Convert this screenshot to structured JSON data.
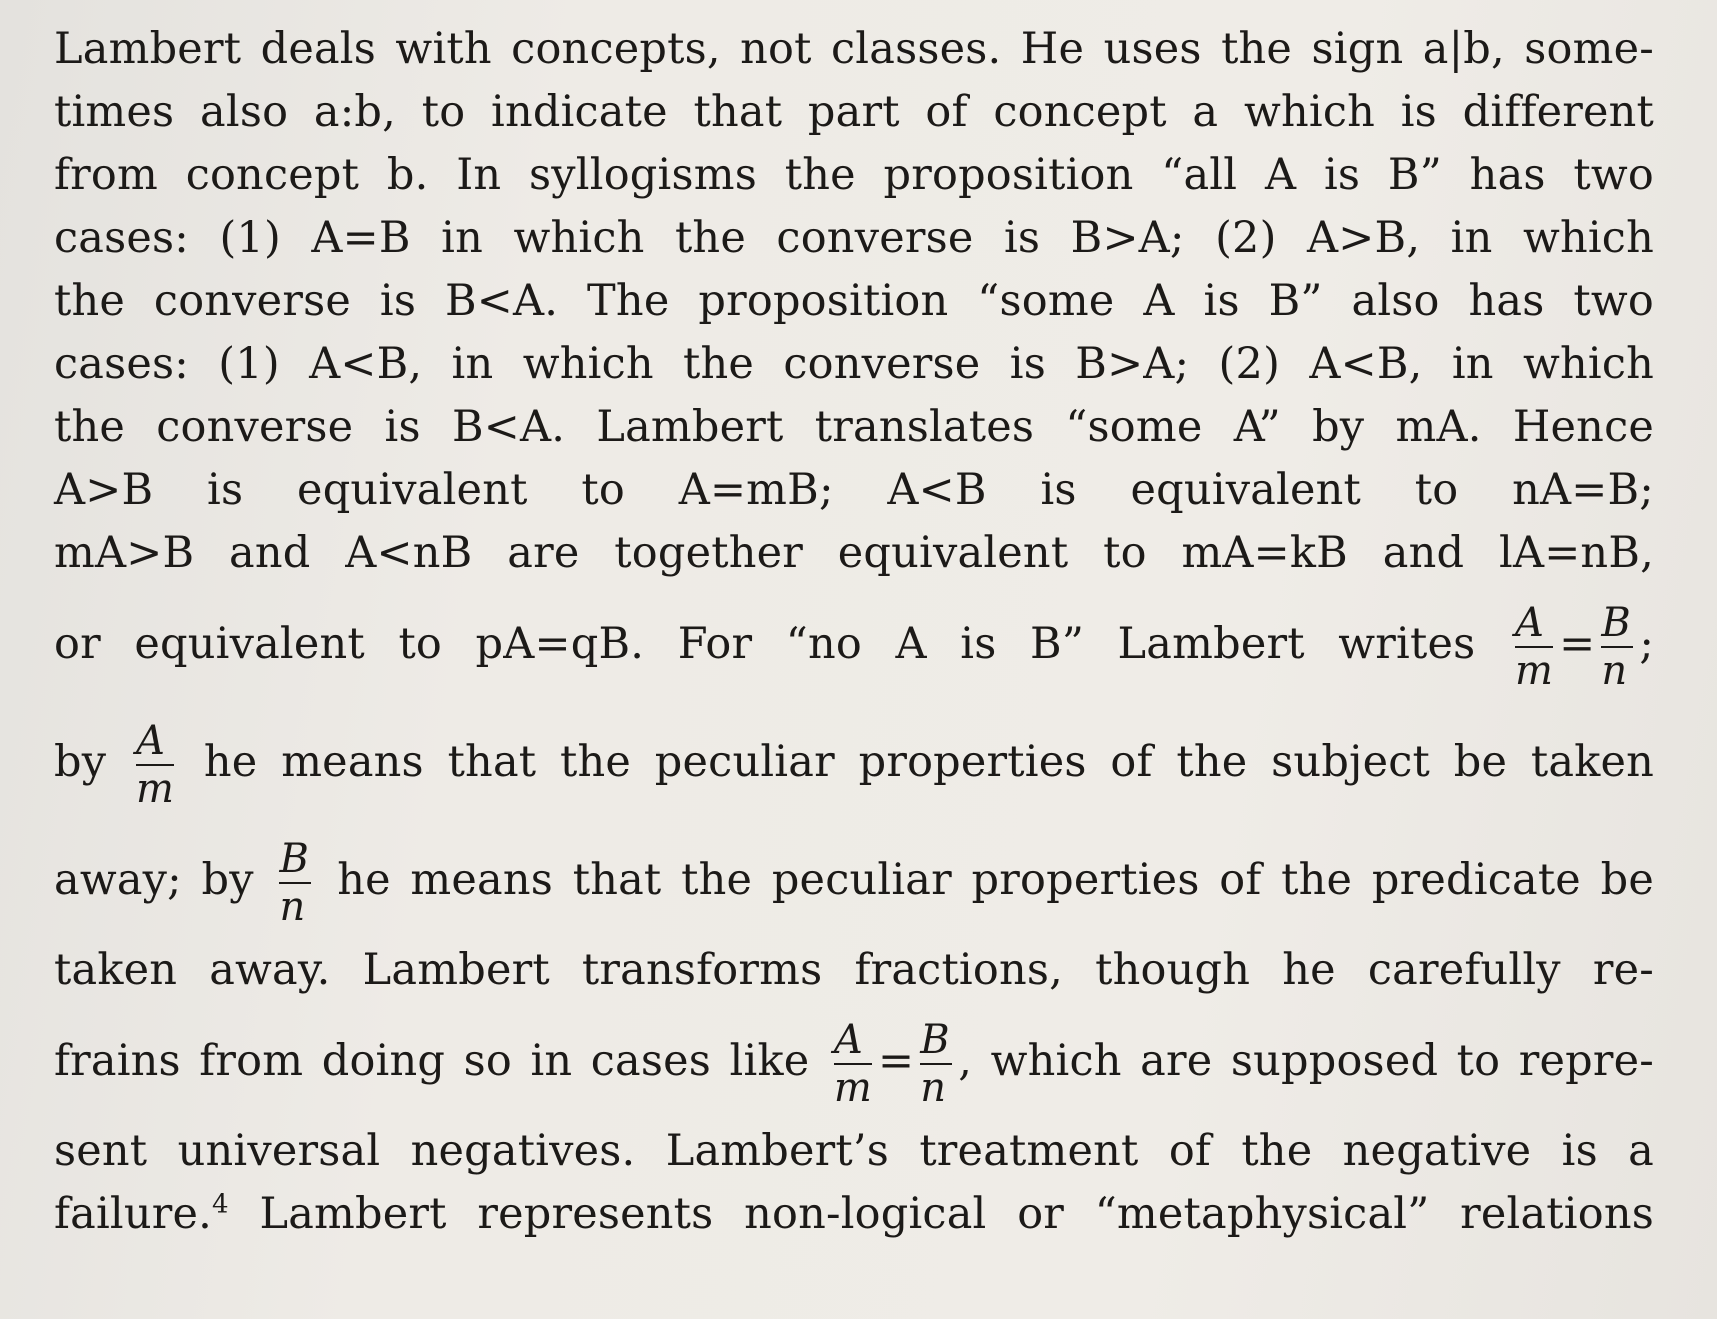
{
  "lines": [
    "Lambert deals with concepts, not classes. He uses the sign a|b, some-",
    "times also a:b, to indicate that part of concept a which is different",
    "from concept b. In syllogisms the proposition “all A is B” has two",
    "cases: (1) A=B in which the converse is B>A; (2) A>B, in which",
    "the converse is B<A. The proposition “some A is B” also has two",
    "cases: (1) A<B, in which the converse is B>A; (2) A<B, in which",
    "the converse is B<A. Lambert translates “some A” by mA. Hence",
    "A>B is equivalent to A=mB; A<B is equivalent to nA=B;",
    "mA>B and A<nB are together equivalent to mA=kB and lA=nB,"
  ],
  "line10": {
    "pre": "or equivalent to pA=qB. For “no A is B” Lambert writes",
    "frac1_num": "A",
    "frac1_den": "m",
    "eq": "=",
    "frac2_num": "B",
    "frac2_den": "n",
    "post": ";"
  },
  "line11": {
    "pre": "by",
    "frac_num": "A",
    "frac_den": "m",
    "post": "he means that the peculiar properties of the subject be taken"
  },
  "line12": {
    "pre": "away; by",
    "frac_num": "B",
    "frac_den": "n",
    "post": "he means that the peculiar properties of the predicate be"
  },
  "line13": "taken away. Lambert transforms fractions, though he carefully re-",
  "line14": {
    "pre": "frains from doing so in cases like",
    "frac1_num": "A",
    "frac1_den": "m",
    "eq": "=",
    "frac2_num": "B",
    "frac2_den": "n",
    "post": ", which are supposed to repre-"
  },
  "line15": "sent universal negatives. Lambert’s treatment of the negative is a",
  "line16": {
    "pre": "failure.",
    "footnote": "4",
    "post": " Lambert represents non-logical or “metaphysical” relations"
  }
}
